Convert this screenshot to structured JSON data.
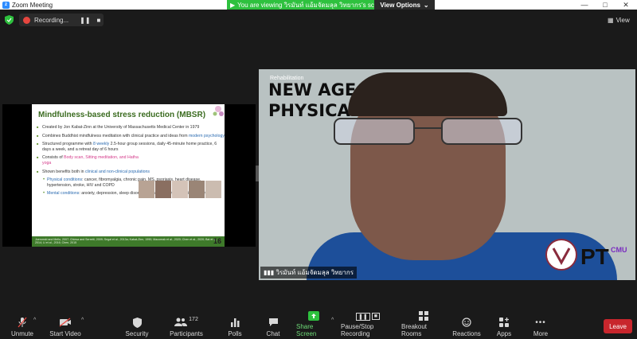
{
  "window": {
    "title": "Zoom Meeting",
    "banner": "You are viewing วิรมันท์ แอ้มจัดมลุล วิทยากร's screen",
    "view_options": "View Options",
    "controls": [
      "—",
      "□",
      "✕"
    ]
  },
  "top": {
    "recording_label": "Recording...",
    "view_label": "View"
  },
  "slide": {
    "title": "Mindfulness-based stress reduction (MBSR)",
    "bullets": [
      {
        "text": "Created by Jon Kabat-Zinn at the University of Massachusetts Medical Center in 1979"
      },
      {
        "text_a": "Combines Buddhist mindfulness meditation with clinical practice and ideas from ",
        "text_b": "modern psychology"
      },
      {
        "text_a": "Structured programme with ",
        "text_b": "8 weekly",
        "text_c": " 2.5-hour group sessions, daily 45-minute home practice, 6 days a week, and a retreat day of 6 hours"
      },
      {
        "text_a": "Consists of ",
        "text_b": "Body scan, Sitting meditation, and Hatha yoga"
      },
      {
        "text_a": "Shown benefits both in ",
        "text_b": "clinical and non-clinical populations"
      }
    ],
    "sub_bullets": [
      {
        "label": "Physical conditions",
        "text": ": cancer, fibromyalgia, chronic pain, MS, psoriasis, heart disease, hypertension, stroke, HIV and COPD"
      },
      {
        "label": "Mental conditions",
        "text": ": anxiety, depression, sleep disorders, emotional and behavioral disorders"
      }
    ],
    "footer": "Joeronski and Mello, 2007; Chiesa and Serretti, 2009; Segal et al., 2013a; Kabat-Zinn, 1990; Macoreak et al., 2020; Chen et al., 2020; Bai et al., 2014; Li et al., 2016; Chen, 2015",
    "page_number": "16"
  },
  "video": {
    "overlay_line1": "NEW AGE",
    "overlay_line2": "PHYSICAL",
    "small_tag": "Rehabilitation",
    "logo_text": "PT",
    "logo_sub": "CMU",
    "participant_name": "วิรมันท์ แอ้มจัดมลุล วิทยากร"
  },
  "toolbar": {
    "unmute": "Unmute",
    "start_video": "Start Video",
    "security": "Security",
    "participants": "Participants",
    "participants_count": "172",
    "polls": "Polls",
    "chat": "Chat",
    "share_screen": "Share Screen",
    "pause_recording": "Pause/Stop Recording",
    "breakout_rooms": "Breakout Rooms",
    "reactions": "Reactions",
    "apps": "Apps",
    "more": "More",
    "leave": "Leave"
  },
  "colors": {
    "banner_green": "#2ec13e",
    "share_green": "#2ec13e",
    "leave_red": "#c8262d",
    "record_red": "#e6463f",
    "zoom_blue": "#2D8CFF"
  }
}
